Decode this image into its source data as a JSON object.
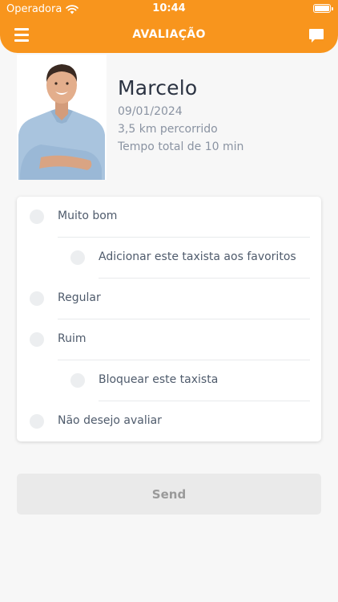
{
  "status_bar": {
    "carrier": "Operadora",
    "time": "10:44"
  },
  "header": {
    "title": "AVALIAÇÃO",
    "menu_icon": "hamburger-icon",
    "chat_icon": "chat-bubble-icon"
  },
  "driver": {
    "name": "Marcelo",
    "date": "09/01/2024",
    "distance": "3,5 km percorrido",
    "duration": "Tempo total de 10 min"
  },
  "rating_options": [
    {
      "label": "Muito bom"
    },
    {
      "label": "Adicionar este taxista aos favoritos"
    },
    {
      "label": "Regular"
    },
    {
      "label": "Ruim"
    },
    {
      "label": "Bloquear este taxista"
    },
    {
      "label": "Não desejo avaliar"
    }
  ],
  "send_button": {
    "label": "Send"
  },
  "colors": {
    "accent": "#f8951d",
    "background": "#f7f7f7"
  }
}
